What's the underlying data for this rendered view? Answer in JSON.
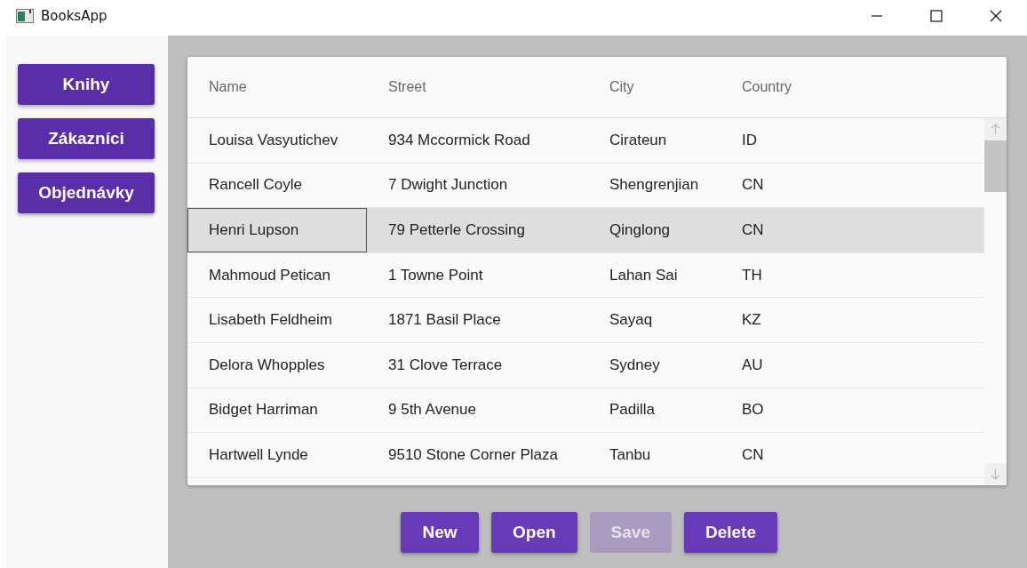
{
  "window": {
    "title": "BooksApp"
  },
  "nav": [
    {
      "label": "Knihy"
    },
    {
      "label": "Zákazníci"
    },
    {
      "label": "Objednávky"
    }
  ],
  "table": {
    "columns": [
      "Name",
      "Street",
      "City",
      "Country"
    ],
    "rows": [
      {
        "cells": [
          "Louisa Vasyutichev",
          "934 Mccormick Road",
          "Cirateun",
          "ID"
        ],
        "selected": false
      },
      {
        "cells": [
          "Rancell Coyle",
          "7 Dwight Junction",
          "Shengrenjian",
          "CN"
        ],
        "selected": false
      },
      {
        "cells": [
          "Henri Lupson",
          "79 Petterle Crossing",
          "Qinglong",
          "CN"
        ],
        "selected": true
      },
      {
        "cells": [
          "Mahmoud Petican",
          "1 Towne Point",
          "Lahan Sai",
          "TH"
        ],
        "selected": false
      },
      {
        "cells": [
          "Lisabeth Feldheim",
          "1871 Basil Place",
          "Sayaq",
          "KZ"
        ],
        "selected": false
      },
      {
        "cells": [
          "Delora Whopples",
          "31 Clove Terrace",
          "Sydney",
          "AU"
        ],
        "selected": false
      },
      {
        "cells": [
          "Bidget Harriman",
          "9 5th Avenue",
          "Padilla",
          "BO"
        ],
        "selected": false
      },
      {
        "cells": [
          "Hartwell Lynde",
          "9510 Stone Corner Plaza",
          "Tanbu",
          "CN"
        ],
        "selected": false
      }
    ]
  },
  "actions": [
    {
      "label": "New",
      "disabled": false
    },
    {
      "label": "Open",
      "disabled": false
    },
    {
      "label": "Save",
      "disabled": true
    },
    {
      "label": "Delete",
      "disabled": false
    }
  ]
}
